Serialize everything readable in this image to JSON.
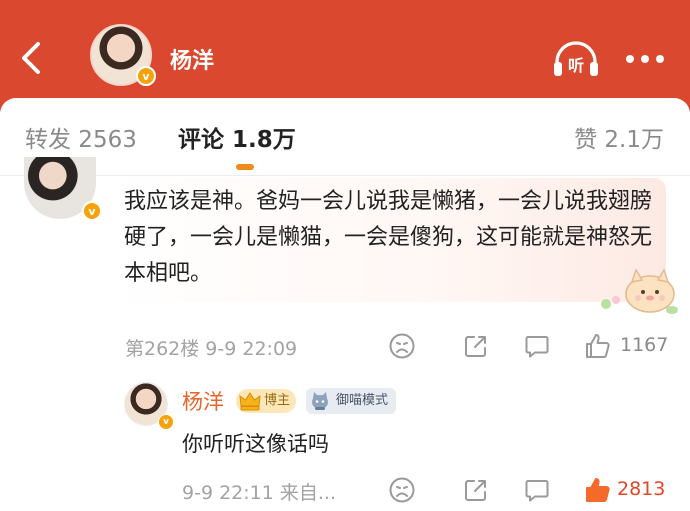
{
  "header": {
    "username": "杨洋",
    "verified_badge": "v",
    "icons": [
      "back-icon",
      "listen-icon",
      "more-icon"
    ],
    "background_color": "#d9482f"
  },
  "tabs": [
    {
      "label": "转发 2563",
      "active": false
    },
    {
      "label": "评论 1.8万",
      "active": true
    },
    {
      "label": "赞 2.1万",
      "active": false
    }
  ],
  "accent_color": "#f08a1b",
  "comment": {
    "verified_badge": "v",
    "text": "我应该是神。爸妈一会儿说我是懒猪，一会儿说我翅膀硬了，一会儿是懒猫，一会是傻狗，这可能就是神怒无本相吧。",
    "meta": "第262楼 9-9 22:09",
    "like_count": "1167",
    "sticker": "cat-sticker"
  },
  "reply": {
    "username": "杨洋",
    "verified_badge": "v",
    "badge_blogger": "博主",
    "badge_mode": "御喵模式",
    "text": "你听听这像话吗",
    "meta": "9-9 22:11 来自...",
    "like_count": "2813",
    "liked": true
  }
}
